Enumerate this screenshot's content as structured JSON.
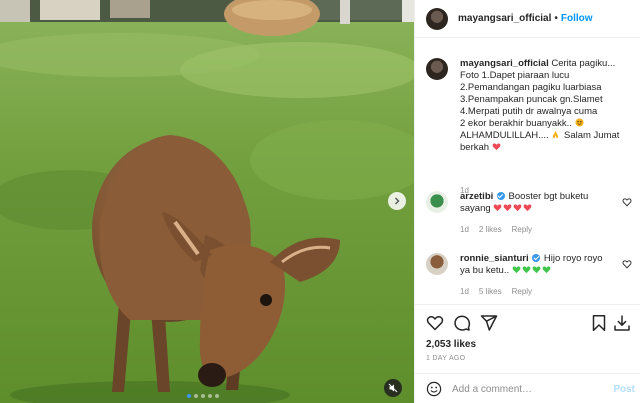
{
  "post": {
    "username": "mayangsari_official",
    "separator": "•",
    "follow_label": "Follow",
    "caption": {
      "username": "mayangsari_official",
      "lines": [
        "Cerita pagiku...",
        "Foto 1.Dapet piaraan lucu",
        "2.Pemandangan pagiku luarbiasa",
        "3.Penampakan puncak gn.Slamet",
        "4.Merpati putih dr awalnya cuma",
        "2 ekor berakhir buanyakk..",
        "ALHAMDULILLAH....",
        "Salam Jumat",
        "berkah"
      ],
      "age": "1d"
    },
    "slides": {
      "count": 5,
      "active_index": 0
    }
  },
  "comments": [
    {
      "username": "arzetibi",
      "verified": true,
      "text_1": "Booster bgt buketu",
      "text_2": "sayang",
      "emoji_color": "#ed4956",
      "age": "1d",
      "likes": "2 likes",
      "reply": "Reply"
    },
    {
      "username": "ronnie_sianturi",
      "verified": true,
      "text_1": "Hijo royo royo",
      "text_2": "ya bu ketu..",
      "emoji_color": "#3ec64b",
      "age": "1d",
      "likes": "5 likes",
      "reply": "Reply"
    }
  ],
  "actions": {
    "likes": "2,053 likes",
    "age": "1 DAY AGO",
    "comment_placeholder": "Add a comment…",
    "post_label": "Post"
  },
  "icons": [
    "chevron-right-icon",
    "mute-icon",
    "heart-icon",
    "comment-icon",
    "share-icon",
    "bookmark-icon",
    "download-icon",
    "emoji-icon"
  ],
  "colors": {
    "accent": "#0095f6",
    "verified": "#3897f0",
    "muted": "#8e8e8e",
    "post_disabled": "#b2dffc"
  }
}
